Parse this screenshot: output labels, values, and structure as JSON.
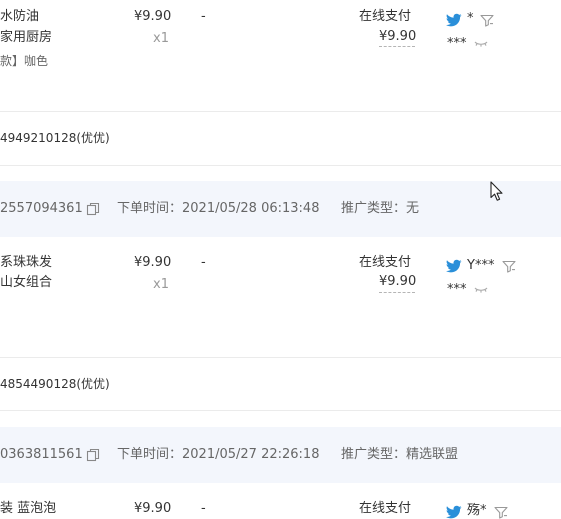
{
  "orders": [
    {
      "product_line1": "水防油",
      "product_line2": "家用厨房",
      "variant": "款】咖色",
      "price": "¥9.90",
      "quantity": "x1",
      "discount": "-",
      "payment_method": "在线支付",
      "paid_amount": "¥9.90",
      "buyer_name": "*",
      "buyer_masked": "***",
      "footer": "4949210128(优优)"
    },
    {
      "order_id": "2557094361",
      "time_label": "下单时间：",
      "time_value": "2021/05/28 06:13:48",
      "promo_label": "推广类型：",
      "promo_value": "无",
      "product_line1": "系珠珠发",
      "product_line2": "山女组合",
      "price": "¥9.90",
      "quantity": "x1",
      "discount": "-",
      "payment_method": "在线支付",
      "paid_amount": "¥9.90",
      "buyer_name": "Y***",
      "buyer_masked": "***",
      "footer": "4854490128(优优)"
    },
    {
      "order_id": "0363811561",
      "time_label": "下单时间：",
      "time_value": "2021/05/27 22:26:18",
      "promo_label": "推广类型：",
      "promo_value": "精选联盟",
      "product_line1": "装 蓝泡泡",
      "price": "¥9.90",
      "discount": "-",
      "payment_method": "在线支付",
      "buyer_name": "殇*"
    }
  ],
  "icons": {
    "buyer": "bird-icon",
    "filter": "filter-icon",
    "toggle": "eye-closed-icon",
    "copy": "copy-icon",
    "cursor": "mouse-cursor-icon"
  },
  "colors": {
    "header_bg": "#f3f6fc",
    "bird_blue": "#2a8fd9",
    "separator": "#ebebeb",
    "text_main": "#333333",
    "text_muted": "#999999"
  }
}
